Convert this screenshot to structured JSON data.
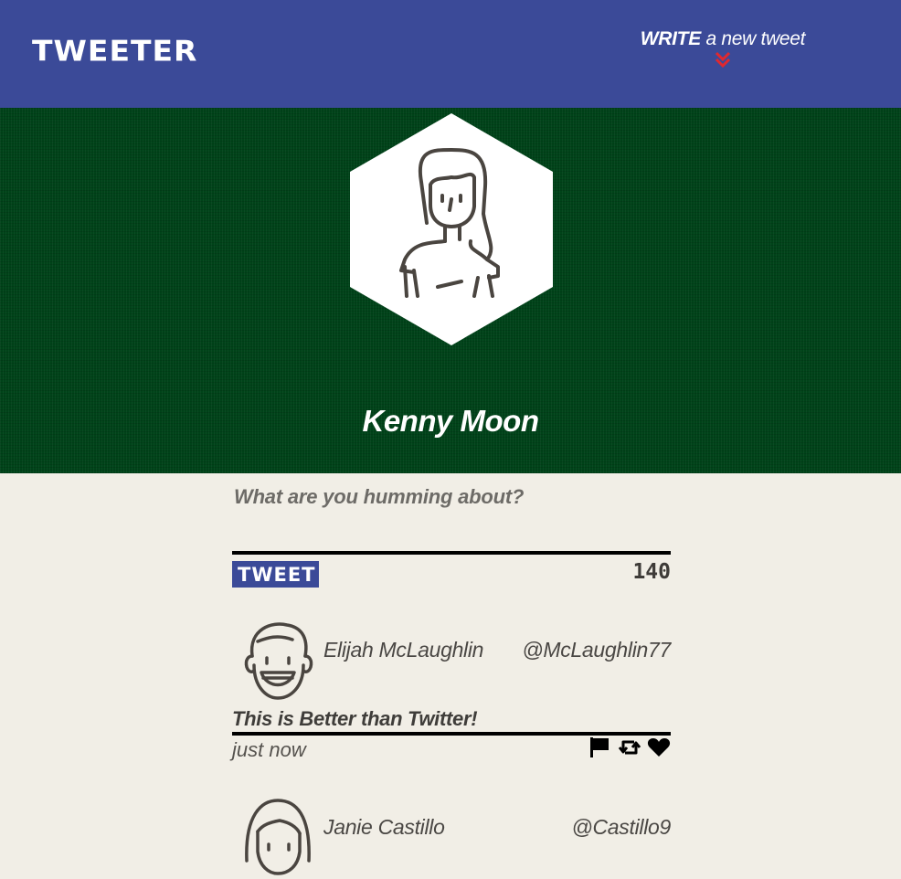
{
  "nav": {
    "brand": "TWEETER",
    "compose_bold": "WRITE",
    "compose_rest": " a new tweet",
    "compose_icon": "double-chevron-down-icon",
    "compose_icon_color": "#e0282e"
  },
  "colors": {
    "nav_bg": "#3b4a98",
    "header_bg": "#004319",
    "page_bg": "#f1eee6",
    "tweet_button_bg": "#3b4a98"
  },
  "profile": {
    "name": "Kenny Moon",
    "avatar_icon": "woman-avatar-icon"
  },
  "compose": {
    "placeholder": "What are you humming about?",
    "button_label": "TWEET",
    "char_count": "140"
  },
  "tweets": [
    {
      "name": "Elijah McLaughlin",
      "handle": "@McLaughlin77",
      "avatar_icon": "smiling-man-avatar-icon",
      "text": "This is Better than Twitter!",
      "time": "just now",
      "actions": [
        "flag-icon",
        "retweet-icon",
        "heart-icon"
      ]
    },
    {
      "name": "Janie Castillo",
      "handle": "@Castillo9",
      "avatar_icon": "woman-avatar-icon"
    }
  ]
}
